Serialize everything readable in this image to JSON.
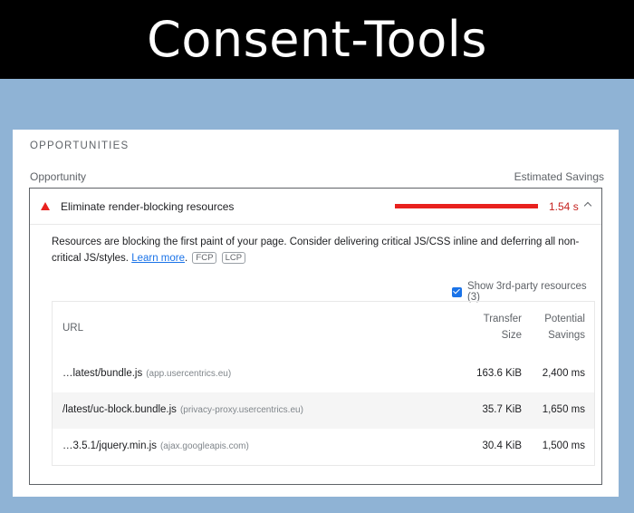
{
  "banner": {
    "title": "Consent-Tools"
  },
  "section": {
    "title": "OPPORTUNITIES",
    "col_left": "Opportunity",
    "col_right": "Estimated Savings"
  },
  "audit": {
    "title": "Eliminate render-blocking resources",
    "savings": "1.54 s",
    "status_color": "#e8211e",
    "description_text": "Resources are blocking the first paint of your page. Consider delivering critical JS/CSS inline and deferring all non-critical JS/styles.",
    "learn_more": "Learn more",
    "badges": [
      "FCP",
      "LCP"
    ],
    "third_party_label": "Show 3rd-party resources (3)",
    "third_party_checked": true
  },
  "table": {
    "headers": {
      "url": "URL",
      "size": "Transfer Size",
      "savings": "Potential Savings"
    },
    "rows": [
      {
        "url": "…latest/bundle.js",
        "host": "(app.usercentrics.eu)",
        "size": "163.6 KiB",
        "savings": "2,400 ms"
      },
      {
        "url": "/latest/uc-block.bundle.js",
        "host": "(privacy-proxy.usercentrics.eu)",
        "size": "35.7 KiB",
        "savings": "1,650 ms"
      },
      {
        "url": "…3.5.1/jquery.min.js",
        "host": "(ajax.googleapis.com)",
        "size": "30.4 KiB",
        "savings": "1,500 ms"
      }
    ]
  }
}
